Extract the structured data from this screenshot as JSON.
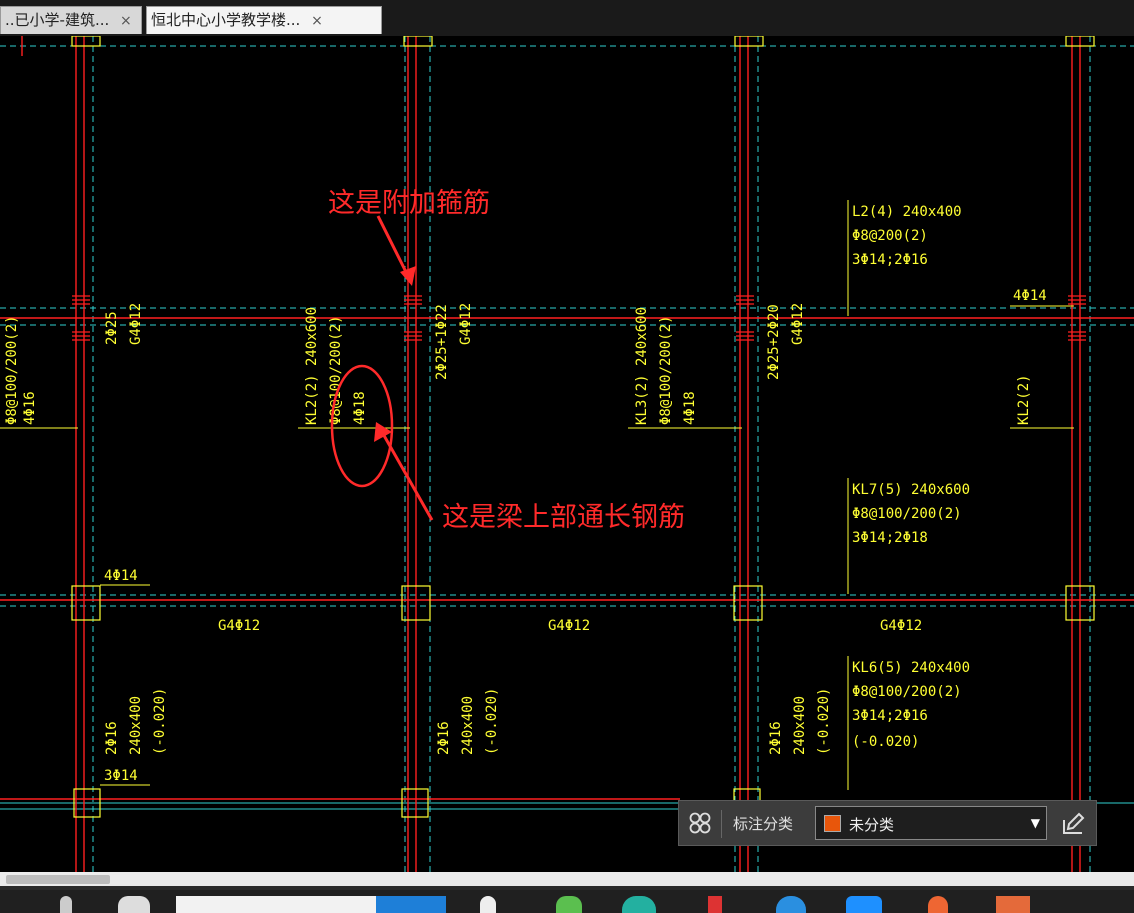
{
  "tabs": [
    {
      "label": "..已小学-建筑...",
      "close": "×",
      "active": false
    },
    {
      "label": "恒北中心小学教学楼...",
      "close": "×",
      "active": true
    }
  ],
  "annotations": {
    "stirrup_note": "这是附加箍筋",
    "top_bar_note": "这是梁上部通长钢筋"
  },
  "labels": {
    "l2_name": "L2(4) 240x400",
    "l2_stirrup": "Φ8@200(2)",
    "l2_bars": "3Φ14;2Φ16",
    "kl7_name": "KL7(5) 240x600",
    "kl7_stirrup": "Φ8@100/200(2)",
    "kl7_bars": "3Φ14;2Φ18",
    "kl6_name": "KL6(5) 240x400",
    "kl6_stirrup": "Φ8@100/200(2)",
    "kl6_bars": "3Φ14;2Φ16",
    "kl6_elev": "(-0.020)",
    "top_right_bars": "4Φ14",
    "mid_left_bars": "4Φ14",
    "bottom_left_bars": "3Φ14",
    "g4_a": "G4Φ12",
    "g4_b": "G4Φ12",
    "g4_c": "G4Φ12",
    "v_left_edge_stirrup": "Φ8@100/200(2)",
    "v_left_edge_bars": "4Φ16",
    "v_col1_top": "2Φ25",
    "v_col1_g4": "G4Φ12",
    "v_kl2_name": "KL2(2) 240x600",
    "v_kl2_stirrup": "Φ8@100/200(2)",
    "v_kl2_bars": "4Φ18",
    "v_col2_top": "2Φ25+1Φ22",
    "v_col2_g4": "G4Φ12",
    "v_kl3_name": "KL3(2) 240x600",
    "v_kl3_stirrup": "Φ8@100/200(2)",
    "v_kl3_bars": "4Φ18",
    "v_col3_top": "2Φ25+2Φ20",
    "v_col3_g4": "G4Φ12",
    "v_kl2_right": "KL2(2)",
    "v_b1_bars": "2Φ16",
    "v_b1_size": "240x400",
    "v_b1_elev": "(-0.020)",
    "v_b2_bars": "2Φ16",
    "v_b2_size": "240x400",
    "v_b2_elev": "(-0.020)",
    "v_b3_bars": "2Φ16",
    "v_b3_size": "240x400",
    "v_b3_elev": "(-0.020)"
  },
  "annotation_panel": {
    "label": "标注分类",
    "selected": "未分类",
    "swatch_color": "#e8560b"
  },
  "colors": {
    "beam_line": "#ff2020",
    "axis_line": "#30d0d0",
    "text": "#ffff33",
    "annotation": "#ff2a2a"
  }
}
